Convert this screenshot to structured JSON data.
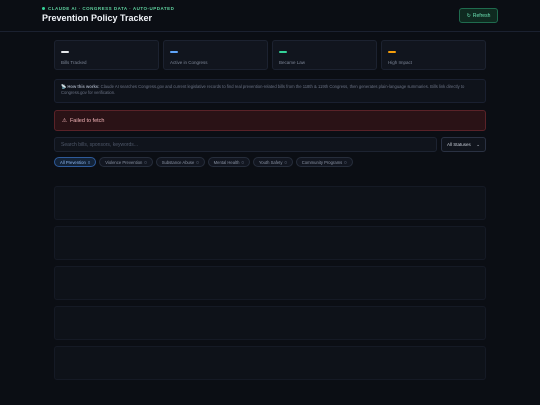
{
  "header": {
    "eyebrow": "CLAUDE AI · CONGRESS DATA · AUTO-UPDATED",
    "title": "Prevention Policy Tracker",
    "refresh_label": "Refresh",
    "refresh_icon": "↻"
  },
  "stats": [
    {
      "label": "Bills Tracked",
      "value": "—",
      "color": "#e5e7eb"
    },
    {
      "label": "Active in Congress",
      "value": "—",
      "color": "#60a5fa"
    },
    {
      "label": "Became Law",
      "value": "—",
      "color": "#34d399"
    },
    {
      "label": "High Impact",
      "value": "—",
      "color": "#f59e0b"
    }
  ],
  "note": {
    "icon": "📡",
    "heading": "How this works:",
    "body": "Claude AI searches Congress.gov and current legislative records to find real prevention-related bills from the 118th & 119th Congress, then generates plain-language summaries. Bills link directly to Congress.gov for verification."
  },
  "error": {
    "icon": "⚠",
    "message": "Failed to fetch"
  },
  "search": {
    "placeholder": "Search bills, sponsors, keywords..."
  },
  "status_filter": {
    "selected": "All Statuses",
    "chevron": "⌄"
  },
  "categories": [
    {
      "label": "All Prevention",
      "count": "0",
      "active": true
    },
    {
      "label": "Violence Prevention",
      "count": "0",
      "active": false
    },
    {
      "label": "Substance Abuse",
      "count": "0",
      "active": false
    },
    {
      "label": "Mental Health",
      "count": "0",
      "active": false
    },
    {
      "label": "Youth Safety",
      "count": "0",
      "active": false
    },
    {
      "label": "Community Programs",
      "count": "0",
      "active": false
    }
  ],
  "colors": {
    "accent": "#34d399",
    "error": "#f3b4b8",
    "active_chip": "#8fbaf5"
  }
}
